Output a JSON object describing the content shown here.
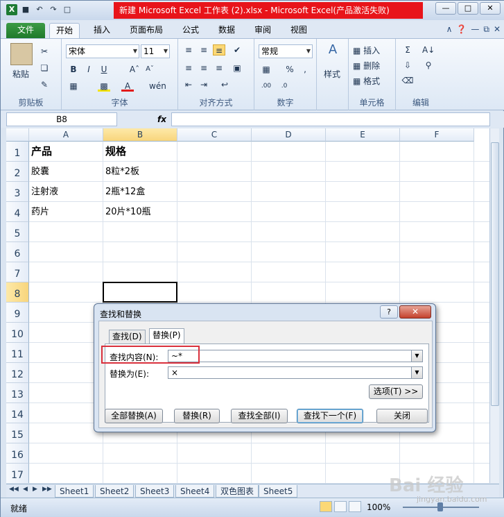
{
  "titlebar": {
    "title": "新建 Microsoft Excel 工作表 (2).xlsx  -  Microsoft Excel(产品激活失败)",
    "qat": [
      "excel-logo",
      "save-icon",
      "undo-icon",
      "redo-icon",
      "print-preview-icon"
    ],
    "window_buttons": [
      "minimize",
      "maximize",
      "close"
    ]
  },
  "tabs": [
    "文件",
    "开始",
    "插入",
    "页面布局",
    "公式",
    "数据",
    "审阅",
    "视图"
  ],
  "active_tab": "开始",
  "ribbon": {
    "clipboard": {
      "label": "剪贴板",
      "paste": "粘贴"
    },
    "font": {
      "label": "字体",
      "font_name": "宋体",
      "font_size": "11"
    },
    "alignment": {
      "label": "对齐方式"
    },
    "number": {
      "label": "数字",
      "format": "常规"
    },
    "styles": {
      "label": "样式"
    },
    "cells": {
      "label": "单元格",
      "insert": "插入",
      "delete": "删除",
      "format": "格式"
    },
    "editing": {
      "label": "编辑"
    }
  },
  "formula_bar": {
    "name_box": "B8",
    "fx": "fx",
    "formula": ""
  },
  "grid": {
    "columns": [
      "A",
      "B",
      "C",
      "D",
      "E",
      "F"
    ],
    "rows": [
      "1",
      "2",
      "3",
      "4",
      "5",
      "6",
      "7",
      "8",
      "9",
      "10",
      "11",
      "12",
      "13",
      "14",
      "15",
      "16",
      "17"
    ],
    "selected_cell": "B8",
    "cells": {
      "A1": "产品",
      "B1": "规格",
      "A2": "胶囊",
      "B2": "8粒*2板",
      "A3": "注射液",
      "B3": "2瓶*12盒",
      "A4": "药片",
      "B4": "20片*10瓶"
    }
  },
  "sheets": [
    "Sheet1",
    "Sheet2",
    "Sheet3",
    "Sheet4",
    "双色图表",
    "Sheet5"
  ],
  "statusbar": {
    "ready": "就绪",
    "zoom": "100%",
    "zoom_percent": 100
  },
  "dialog": {
    "title": "查找和替换",
    "tab_find": "查找(D)",
    "tab_replace": "替换(P)",
    "find_label": "查找内容(N):",
    "find_value": "~*",
    "replace_label": "替换为(E):",
    "replace_value": "×",
    "options_btn": "选项(T) >>",
    "replace_all": "全部替换(A)",
    "replace": "替换(R)",
    "find_all": "查找全部(I)",
    "find_next": "查找下一个(F)",
    "close": "关闭"
  },
  "watermark": {
    "text": "Bai 经验",
    "sub": "jingyan.baidu.com"
  }
}
